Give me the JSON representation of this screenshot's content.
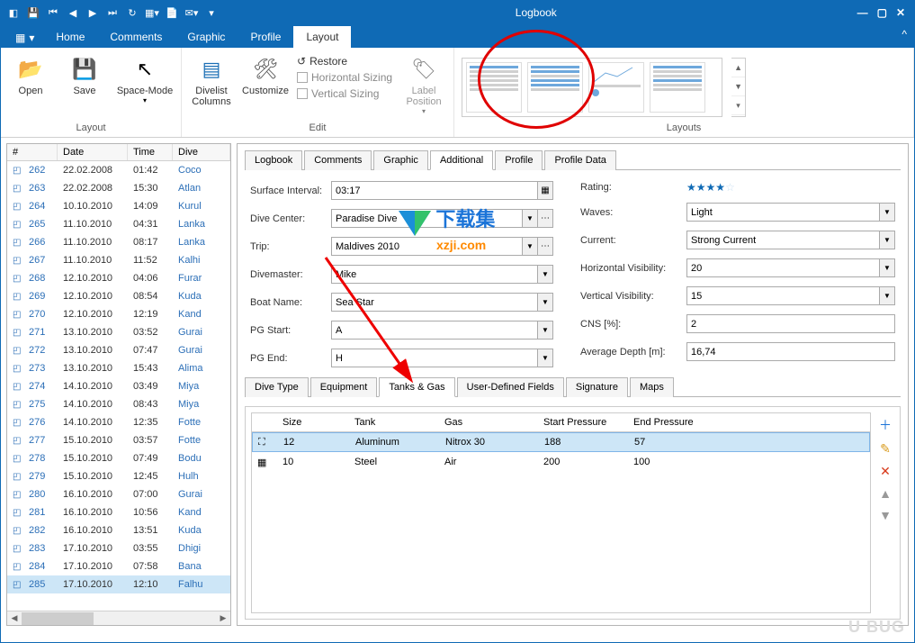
{
  "window": {
    "title": "Logbook"
  },
  "ribbon": {
    "file": "▦ ▾",
    "tabs": [
      "Home",
      "Comments",
      "Graphic",
      "Profile",
      "Layout"
    ],
    "active": 4,
    "layout_group": "Layout",
    "edit_group": "Edit",
    "layouts_group": "Layouts",
    "btn_open": "Open",
    "btn_save": "Save",
    "btn_space": "Space-Mode",
    "btn_divelist": "Divelist\nColumns",
    "btn_customize": "Customize",
    "btn_label": "Label\nPosition",
    "restore": "Restore",
    "hsizing": "Horizontal Sizing",
    "vsizing": "Vertical Sizing"
  },
  "divelist": {
    "h_num": "#",
    "h_date": "Date",
    "h_time": "Time",
    "h_loc": "Dive",
    "rows": [
      {
        "n": "262",
        "d": "22.02.2008",
        "t": "01:42",
        "l": "Coco"
      },
      {
        "n": "263",
        "d": "22.02.2008",
        "t": "15:30",
        "l": "Atlan"
      },
      {
        "n": "264",
        "d": "10.10.2010",
        "t": "14:09",
        "l": "Kurul"
      },
      {
        "n": "265",
        "d": "11.10.2010",
        "t": "04:31",
        "l": "Lanka"
      },
      {
        "n": "266",
        "d": "11.10.2010",
        "t": "08:17",
        "l": "Lanka"
      },
      {
        "n": "267",
        "d": "11.10.2010",
        "t": "11:52",
        "l": "Kalhi"
      },
      {
        "n": "268",
        "d": "12.10.2010",
        "t": "04:06",
        "l": "Furar"
      },
      {
        "n": "269",
        "d": "12.10.2010",
        "t": "08:54",
        "l": "Kuda"
      },
      {
        "n": "270",
        "d": "12.10.2010",
        "t": "12:19",
        "l": "Kand"
      },
      {
        "n": "271",
        "d": "13.10.2010",
        "t": "03:52",
        "l": "Gurai"
      },
      {
        "n": "272",
        "d": "13.10.2010",
        "t": "07:47",
        "l": "Gurai"
      },
      {
        "n": "273",
        "d": "13.10.2010",
        "t": "15:43",
        "l": "Alima"
      },
      {
        "n": "274",
        "d": "14.10.2010",
        "t": "03:49",
        "l": "Miya"
      },
      {
        "n": "275",
        "d": "14.10.2010",
        "t": "08:43",
        "l": "Miya"
      },
      {
        "n": "276",
        "d": "14.10.2010",
        "t": "12:35",
        "l": "Fotte"
      },
      {
        "n": "277",
        "d": "15.10.2010",
        "t": "03:57",
        "l": "Fotte"
      },
      {
        "n": "278",
        "d": "15.10.2010",
        "t": "07:49",
        "l": "Bodu"
      },
      {
        "n": "279",
        "d": "15.10.2010",
        "t": "12:45",
        "l": "Hulh"
      },
      {
        "n": "280",
        "d": "16.10.2010",
        "t": "07:00",
        "l": "Gurai"
      },
      {
        "n": "281",
        "d": "16.10.2010",
        "t": "10:56",
        "l": "Kand"
      },
      {
        "n": "282",
        "d": "16.10.2010",
        "t": "13:51",
        "l": "Kuda"
      },
      {
        "n": "283",
        "d": "17.10.2010",
        "t": "03:55",
        "l": "Dhigi"
      },
      {
        "n": "284",
        "d": "17.10.2010",
        "t": "07:58",
        "l": "Bana"
      },
      {
        "n": "285",
        "d": "17.10.2010",
        "t": "12:10",
        "l": "Falhu"
      }
    ],
    "selected": 23
  },
  "detail_tabs": [
    "Logbook",
    "Comments",
    "Graphic",
    "Additional",
    "Profile",
    "Profile Data"
  ],
  "detail_active": 3,
  "form": {
    "surface_interval_l": "Surface Interval:",
    "surface_interval": "03:17",
    "dive_center_l": "Dive Center:",
    "dive_center": "Paradise Dive",
    "trip_l": "Trip:",
    "trip": "Maldives 2010",
    "divemaster_l": "Divemaster:",
    "divemaster": "Mike",
    "boat_l": "Boat Name:",
    "boat": "Sea Star",
    "pgstart_l": "PG Start:",
    "pgstart": "A",
    "pgend_l": "PG End:",
    "pgend": "H",
    "rating_l": "Rating:",
    "rating": 4,
    "waves_l": "Waves:",
    "waves": "Light",
    "current_l": "Current:",
    "current": "Strong Current",
    "hviz_l": "Horizontal Visibility:",
    "hviz": "20",
    "vviz_l": "Vertical Visibility:",
    "vviz": "15",
    "cns_l": "CNS [%]:",
    "cns": "2",
    "avgdepth_l": "Average Depth [m]:",
    "avgdepth": "16,74"
  },
  "subtabs": [
    "Dive Type",
    "Equipment",
    "Tanks & Gas",
    "User-Defined Fields",
    "Signature",
    "Maps"
  ],
  "subtab_active": 2,
  "tanks": {
    "h_size": "Size",
    "h_tank": "Tank",
    "h_gas": "Gas",
    "h_sp": "Start Pressure",
    "h_ep": "End Pressure",
    "rows": [
      {
        "icon": "⛶",
        "size": "12",
        "tank": "Aluminum",
        "gas": "Nitrox 30",
        "sp": "188",
        "ep": "57"
      },
      {
        "icon": "▦",
        "size": "10",
        "tank": "Steel",
        "gas": "Air",
        "sp": "200",
        "ep": "100"
      }
    ],
    "selected": 0
  },
  "wm": {
    "a": "下载集",
    "b": "xzji.com",
    "c": "U BUG"
  }
}
